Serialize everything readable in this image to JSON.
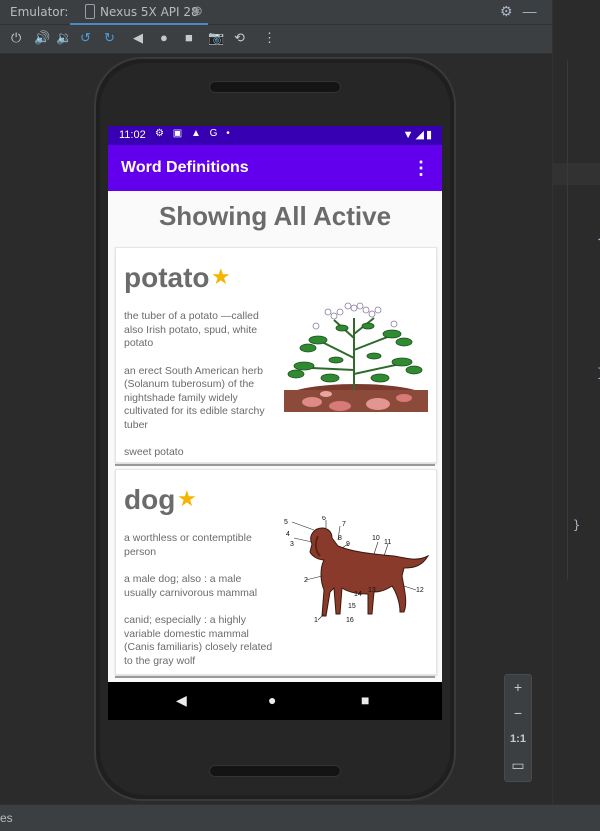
{
  "ide": {
    "emulator_label": "Emulator:",
    "device_tab": "Nexus 5X API 28",
    "tab_close": "⊗",
    "settings_icon": "gear-icon",
    "minimize_icon": "minus-icon",
    "bottom_fragment": "es",
    "code_brackets": [
      "{",
      "}",
      "}"
    ],
    "zoom_controls": {
      "zoom_in": "+",
      "zoom_out": "−",
      "ratio": "1:1"
    }
  },
  "status_bar": {
    "time": "11:02",
    "left_icons": "⚙ ▣ ▲ G •",
    "right_icons": "▼◢▮"
  },
  "app_bar": {
    "title": "Word Definitions",
    "overflow_icon": "⋮"
  },
  "page": {
    "heading": "Showing All Active"
  },
  "cards": [
    {
      "word": "potato",
      "favorite": true,
      "definitions": [
        "the tuber of a potato —called also Irish potato, spud, white potato",
        "an erect South American herb (Solanum tuberosum) of the nightshade family widely cultivated for its edible starchy tuber",
        "sweet potato"
      ]
    },
    {
      "word": "dog",
      "favorite": true,
      "definitions": [
        "a worthless or contemptible person",
        "a male dog; also : a male usually carnivorous mammal",
        "canid; especially : a highly variable domestic mammal (Canis familiaris) closely related to the gray wolf"
      ],
      "diagram_labels": [
        "1",
        "2",
        "3",
        "4",
        "5",
        "6",
        "7",
        "8",
        "9",
        "10",
        "11",
        "12",
        "13",
        "14",
        "15",
        "16"
      ]
    }
  ],
  "colors": {
    "status_bar": "#3700b3",
    "app_bar": "#6200ee",
    "star": "#f5b400",
    "text_gray": "#6b6b6b"
  }
}
